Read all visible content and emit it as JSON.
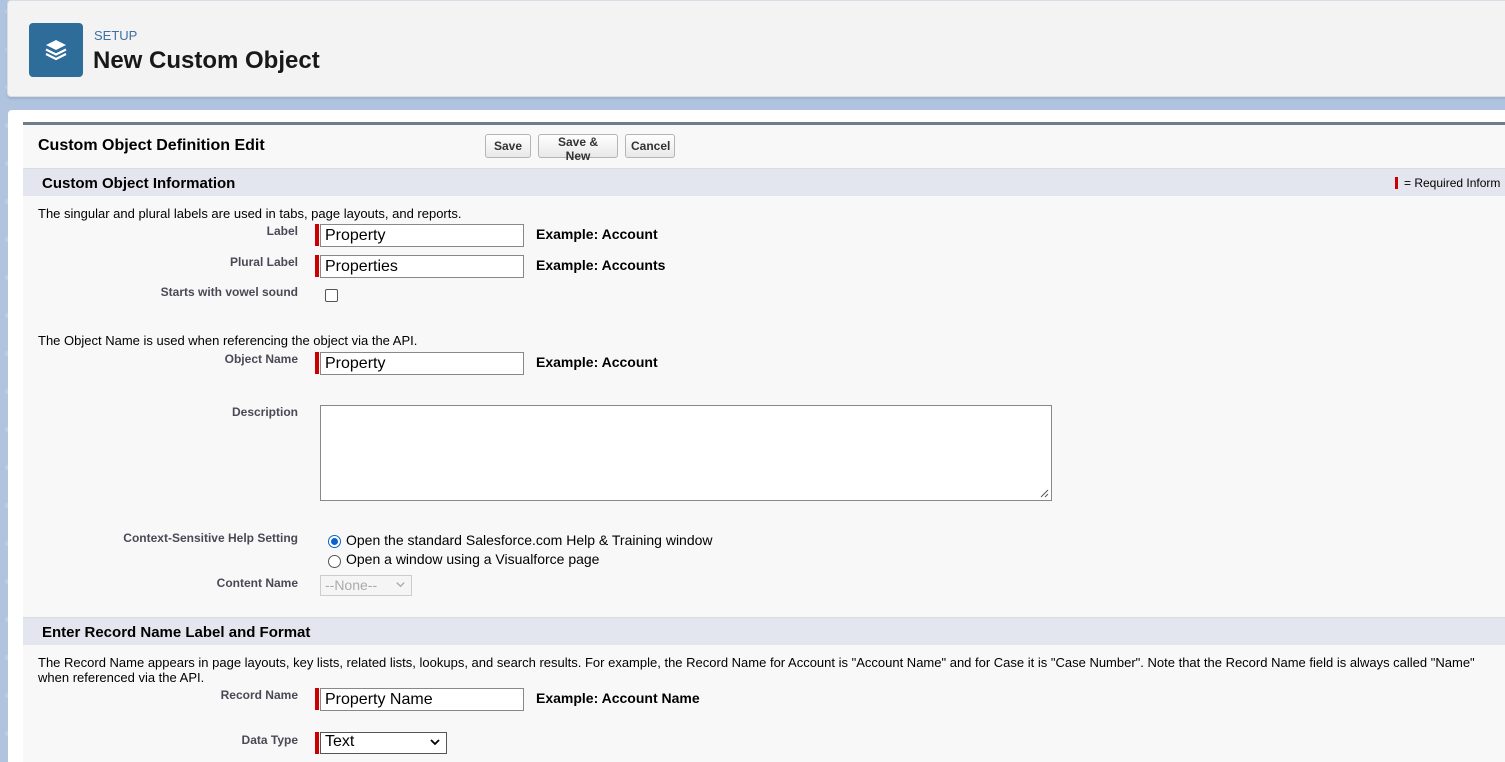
{
  "header": {
    "setup_label": "SETUP",
    "title": "New Custom Object",
    "icon": "layers-icon",
    "icon_color": "#2e6c99"
  },
  "form": {
    "title": "Custom Object Definition Edit",
    "buttons": {
      "save": "Save",
      "save_new": "Save & New",
      "cancel": "Cancel"
    },
    "required_legend": "= Required Inform",
    "required_color": "#cc0000"
  },
  "section1": {
    "title": "Custom Object Information",
    "intro_labels": "The singular and plural labels are used in tabs, page layouts, and reports.",
    "label": {
      "label": "Label",
      "value": "Property",
      "example": "Example:  Account"
    },
    "plural": {
      "label": "Plural Label",
      "value": "Properties",
      "example": "Example:  Accounts"
    },
    "vowel": {
      "label": "Starts with vowel sound",
      "checked": false
    },
    "intro_object_name": "The Object Name is used when referencing the object via the API.",
    "object_name": {
      "label": "Object Name",
      "value": "Property",
      "example": "Example:  Account"
    },
    "description": {
      "label": "Description",
      "value": ""
    },
    "help": {
      "label": "Context-Sensitive Help Setting",
      "option1": "Open the standard Salesforce.com Help & Training window",
      "option2": "Open a window using a Visualforce page",
      "selected": "option1"
    },
    "content_name": {
      "label": "Content Name",
      "value": "--None--"
    }
  },
  "section2": {
    "title": "Enter Record Name Label and Format",
    "intro": "The Record Name appears in page layouts, key lists, related lists, lookups, and search results. For example, the Record Name for Account is \"Account Name\" and for Case it is \"Case Number\". Note that the Record Name field is always called \"Name\" when referenced via the API.",
    "record_name": {
      "label": "Record Name",
      "value": "Property Name",
      "example": "Example:  Account Name"
    },
    "data_type": {
      "label": "Data Type",
      "value": "Text"
    }
  }
}
